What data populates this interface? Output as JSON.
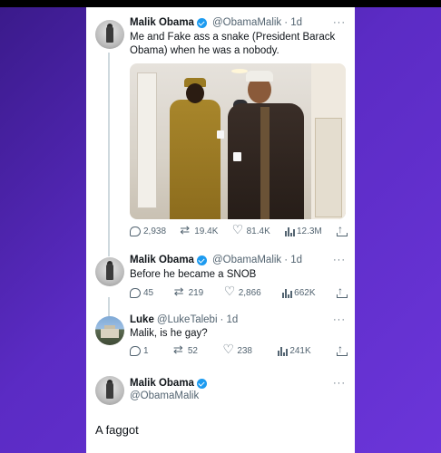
{
  "tweets": [
    {
      "name": "Malik Obama",
      "handle": "@ObamaMalik",
      "time": "· 1d",
      "text": "Me and Fake ass a snake (President Barack Obama) when he was a nobody.",
      "stats": {
        "replies": "2,938",
        "retweets": "19.4K",
        "likes": "81.4K",
        "views": "12.3M"
      }
    },
    {
      "name": "Malik Obama",
      "handle": "@ObamaMalik",
      "time": "· 1d",
      "text": "Before he became a SNOB",
      "stats": {
        "replies": "45",
        "retweets": "219",
        "likes": "2,866",
        "views": "662K"
      }
    },
    {
      "name": "Luke",
      "handle": "@LukeTalebi",
      "time": "· 1d",
      "text": "Malik, is he gay?",
      "stats": {
        "replies": "1",
        "retweets": "52",
        "likes": "238",
        "views": "241K"
      }
    }
  ],
  "focus_tweet": {
    "name": "Malik Obama",
    "handle": "@ObamaMalik",
    "text": "A faggot"
  },
  "more_glyph": "···",
  "colors": {
    "verified": "#1d9bf0",
    "muted": "#536471",
    "text": "#0f1419",
    "background": "#5b2bc4"
  }
}
